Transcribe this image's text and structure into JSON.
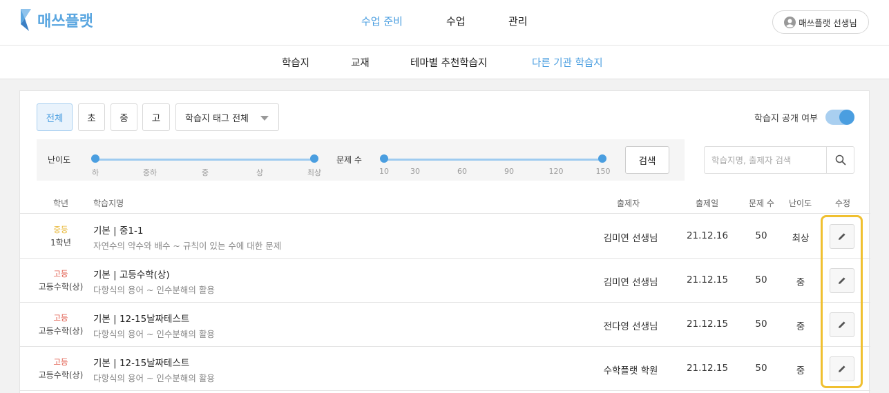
{
  "brand": {
    "name": "매쓰플랫"
  },
  "nav": {
    "items": [
      "수업 준비",
      "수업",
      "관리"
    ],
    "active": 0
  },
  "user": {
    "label": "매쓰플랫 선생님"
  },
  "subnav": {
    "items": [
      "학습지",
      "교재",
      "테마별 추천학습지",
      "다른 기관 학습지"
    ],
    "active": 3
  },
  "filters": {
    "levels": [
      "전체",
      "초",
      "중",
      "고"
    ],
    "level_active": 0,
    "tag_select": "학습지 태그 전체",
    "public_toggle_label": "학습지 공개 여부",
    "public_toggle_on": true,
    "difficulty_label": "난이도",
    "difficulty_ticks": [
      "하",
      "중하",
      "중",
      "상",
      "최상"
    ],
    "difficulty_range": [
      "하",
      "최상"
    ],
    "count_label": "문제 수",
    "count_ticks": [
      "10",
      "30",
      "60",
      "90",
      "120",
      "150"
    ],
    "count_range": [
      10,
      150
    ],
    "search_button": "검색",
    "search_placeholder": "학습지명, 출제자 검색"
  },
  "table": {
    "headers": [
      "학년",
      "학습지명",
      "출제자",
      "출제일",
      "문제 수",
      "난이도",
      "수정"
    ],
    "rows": [
      {
        "level": "중등",
        "course": "1학년",
        "title": "기본 | 중1-1",
        "subtitle": "자연수의 약수와 배수 ~ 규칙이 있는 수에 대한 문제",
        "author": "김미연 선생님",
        "date": "21.12.16",
        "count": "50",
        "difficulty": "최상"
      },
      {
        "level": "고등",
        "course": "고등수학(상)",
        "title": "기본 | 고등수학(상)",
        "subtitle": "다항식의 용어 ~ 인수분해의 활용",
        "author": "김미연 선생님",
        "date": "21.12.15",
        "count": "50",
        "difficulty": "중"
      },
      {
        "level": "고등",
        "course": "고등수학(상)",
        "title": "기본 | 12-15날짜테스트",
        "subtitle": "다항식의 용어 ~ 인수분해의 활용",
        "author": "전다영 선생님",
        "date": "21.12.15",
        "count": "50",
        "difficulty": "중"
      },
      {
        "level": "고등",
        "course": "고등수학(상)",
        "title": "기본 | 12-15날짜테스트",
        "subtitle": "다항식의 용어 ~ 인수분해의 활용",
        "author": "수학플랫 학원",
        "date": "21.12.15",
        "count": "50",
        "difficulty": "중"
      }
    ]
  },
  "colors": {
    "accent": "#4a9ee0",
    "middle_level": "#e8b83a",
    "high_level": "#e05a4a",
    "highlight": "#f0c030"
  }
}
